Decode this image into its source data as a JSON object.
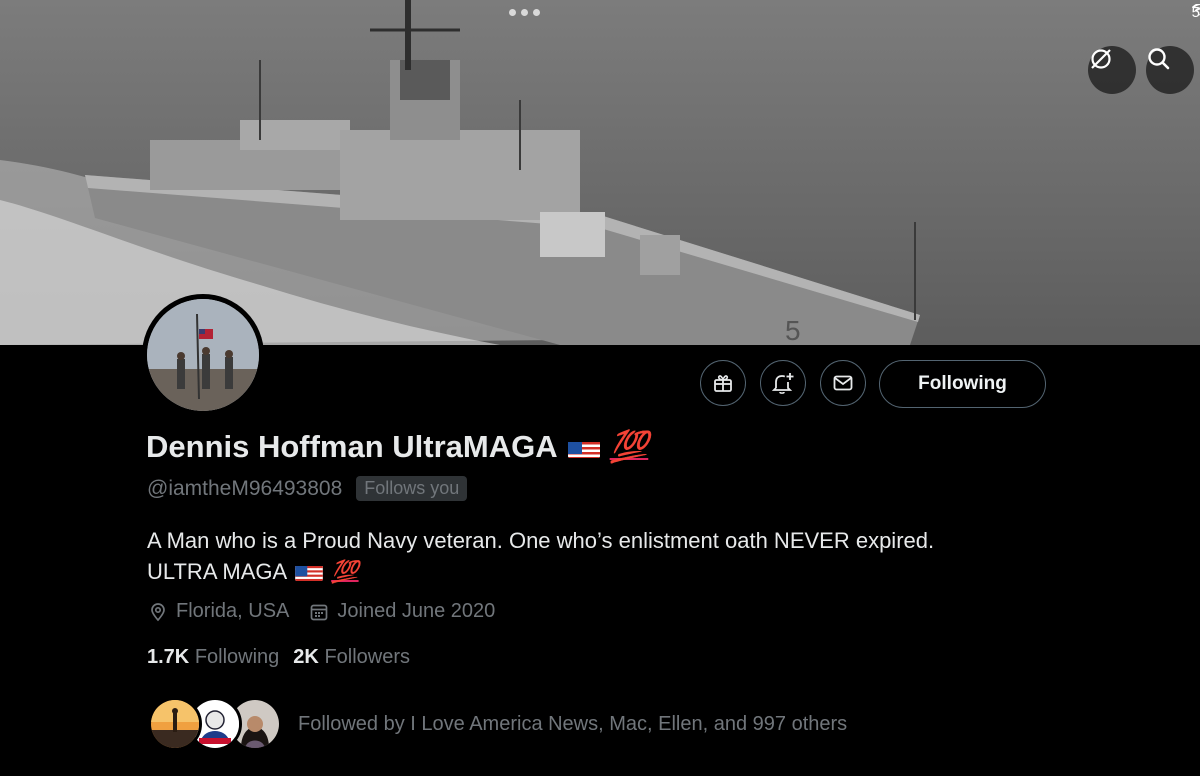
{
  "status_bar": {
    "battery_text": "5"
  },
  "header": {
    "buttons": [
      {
        "icon": "grok-icon"
      },
      {
        "icon": "search-icon"
      }
    ]
  },
  "profile": {
    "display_name": "Dennis Hoffman UltraMAGA",
    "name_emoji_hundred": "💯",
    "handle": "@iamtheM96493808",
    "follows_you_badge": "Follows you",
    "bio_line1": "A Man who is a Proud Navy veteran. One who’s enlistment oath NEVER expired.",
    "bio_line2": "ULTRA MAGA",
    "bio_emoji_hundred": "💯",
    "location": "Florida, USA",
    "joined": "Joined June 2020",
    "following_count": "1.7K",
    "following_label": "Following",
    "followers_count": "2K",
    "followers_label": "Followers",
    "follow_button_label": "Following",
    "followed_by_text": "Followed by I Love America News, Mac, Ellen, and 997 others"
  },
  "actions": [
    {
      "icon": "gift-icon"
    },
    {
      "icon": "bell-plus-icon"
    },
    {
      "icon": "mail-icon"
    }
  ],
  "colors": {
    "background": "#000000",
    "text": "#e7e9ea",
    "secondary": "#71767b",
    "border": "#536471"
  }
}
